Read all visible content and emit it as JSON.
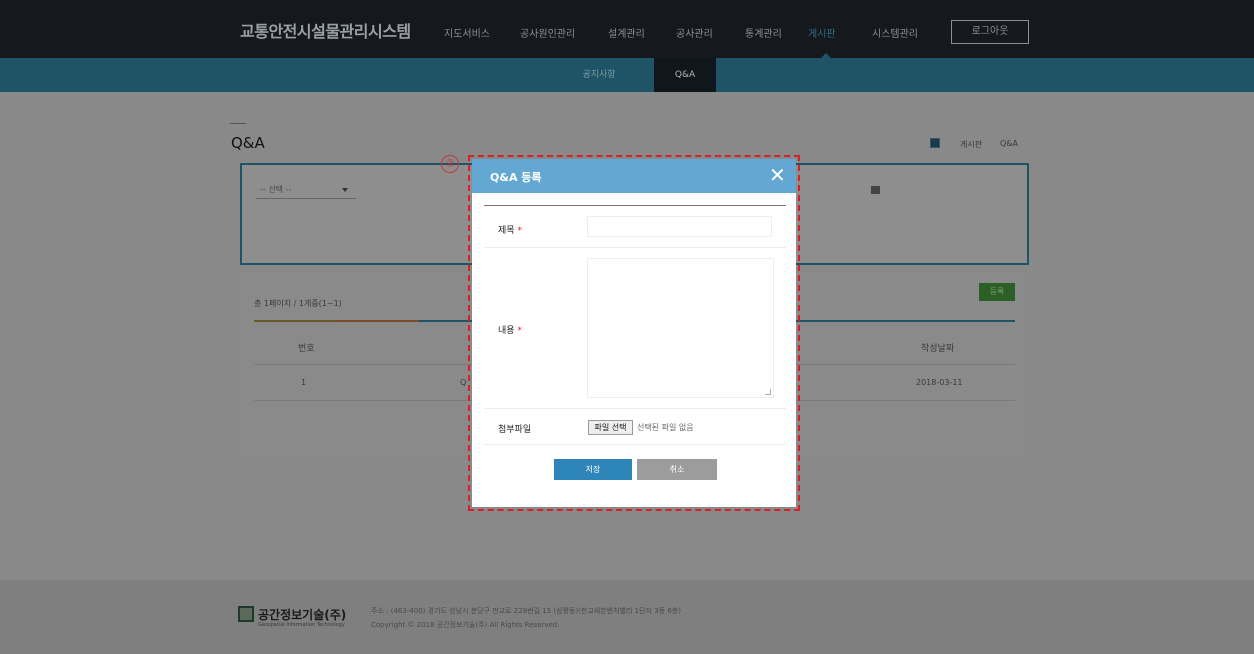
{
  "header": {
    "brand": "교통안전시설물관리시스템",
    "nav": [
      "지도서비스",
      "공사원인관리",
      "설계관리",
      "공사관리",
      "통계관리",
      "게시판",
      "시스템관리"
    ],
    "active_nav": "게시판",
    "logout_label": "로그아웃"
  },
  "subnav": {
    "items": [
      "공지사항",
      "Q&A"
    ],
    "active": "Q&A"
  },
  "page": {
    "title": "Q&A",
    "breadcrumb": [
      "게시판",
      "Q&A"
    ],
    "select_label": "-- 선택 --",
    "count_text": "총 1페이지 / 1게중(1~1)",
    "register_button": "등록",
    "table": {
      "headers": [
        "번호",
        "작성날짜"
      ],
      "rows": [
        {
          "num": "1",
          "title_initial": "Q",
          "date": "2018-03-11"
        }
      ]
    }
  },
  "modal": {
    "step": "②",
    "title": "Q&A 등록",
    "close_symbol": "✕",
    "fields": {
      "subject_label": "제목",
      "content_label": "내용",
      "attachment_label": "첨부파일",
      "required_mark": "*",
      "file_button": "파일 선택",
      "file_none": "선택된 파일 없음"
    },
    "save_label": "저장",
    "cancel_label": "취소"
  },
  "footer": {
    "company": "공간정보기술(주)",
    "company_sub": "Geospatial Information Technology",
    "address": "주소 : (463-400) 경기도 성남시 분당구 판교로 228번길 15 (삼평동)(판교세븐벤처밸리 1단지 3동 6층)",
    "copyright": "Copyright © 2018 공간정보기술(주) All Rights Reserved."
  },
  "colors": {
    "modal_header": "#62a8d2",
    "save_button": "#2e86b8",
    "cancel_button": "#9c9c9c",
    "highlight_border": "#d8202a"
  }
}
